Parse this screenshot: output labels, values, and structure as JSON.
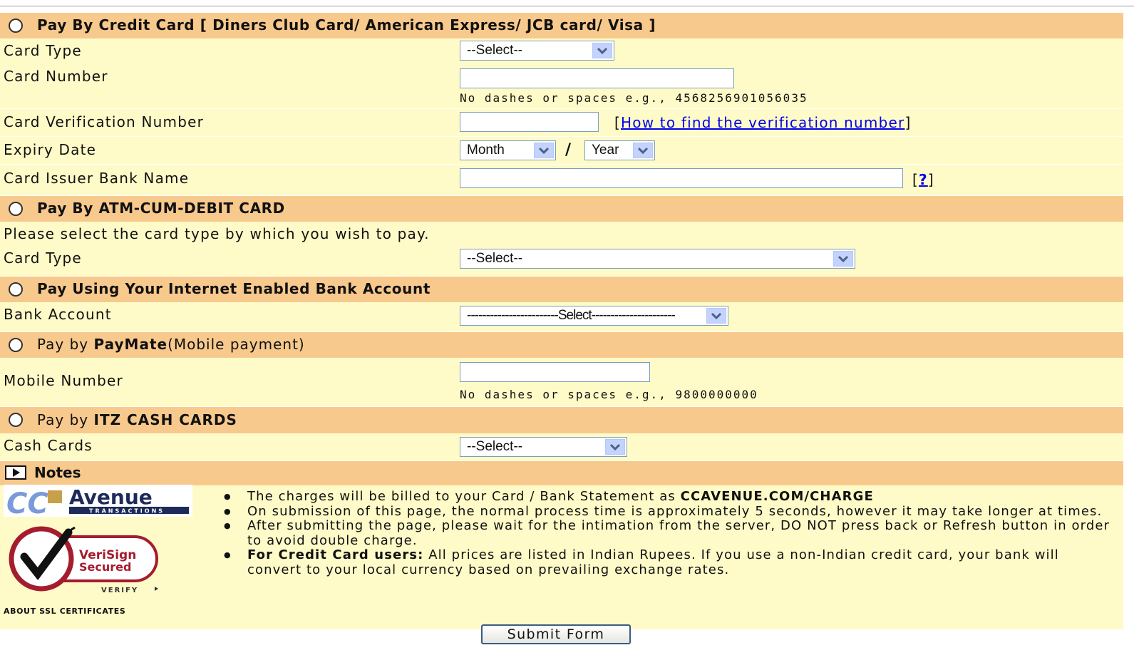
{
  "credit_card": {
    "title": "Pay By Credit Card [ Diners Club Card/ American Express/ JCB card/ Visa ]",
    "card_type_label": "Card Type",
    "card_type_value": "--Select--",
    "card_number_label": "Card Number",
    "card_number_hint": "No dashes or spaces e.g., 4568256901056035",
    "cvv_label": "Card Verification Number",
    "cvv_link": "How to find the verification number",
    "expiry_label": "Expiry Date",
    "expiry_month": "Month",
    "expiry_separator": "/",
    "expiry_year": "Year",
    "issuer_label": "Card Issuer Bank Name",
    "issuer_help": "?"
  },
  "debit_card": {
    "title": "Pay By ATM-CUM-DEBIT CARD",
    "instruction": "Please select the card type by which you wish to pay.",
    "card_type_label": "Card Type",
    "card_type_value": "--Select--"
  },
  "net_banking": {
    "title": "Pay Using Your Internet Enabled Bank Account",
    "bank_label": "Bank Account",
    "bank_value": "------------------------Select----------------------"
  },
  "paymate": {
    "title_prefix": "Pay by ",
    "title_bold": "PayMate",
    "title_suffix": "(Mobile payment)",
    "mobile_label": "Mobile Number",
    "mobile_hint": "No dashes or spaces e.g., 9800000000"
  },
  "itz": {
    "title_prefix": "Pay by ",
    "title_bold": "ITZ CASH CARDS",
    "cash_label": "Cash Cards",
    "cash_value": "--Select--"
  },
  "notes": {
    "title": "Notes",
    "items": [
      {
        "bold": "",
        "text": "The charges will be billed to your Card / Bank Statement as ",
        "tail_bold": "CCAVENUE.COM/CHARGE"
      },
      {
        "bold": "",
        "text": "On submission of this page, the normal process time is approximately 5 seconds, however it may take longer at times.",
        "tail_bold": ""
      },
      {
        "bold": "",
        "text": "After submitting the page, please wait for the intimation from the server, DO NOT press back or Refresh button in order to avoid double charge.",
        "tail_bold": ""
      },
      {
        "bold": "For Credit Card users:",
        "text": " All prices are listed in Indian Rupees. If you use a non-Indian credit card, your bank will convert to your local currency based on prevailing exchange rates.",
        "tail_bold": ""
      }
    ]
  },
  "logos": {
    "ccavenue_main": "Avenue",
    "ccavenue_sub": "TRANSACTIONS",
    "verisign_line1": "VeriSign",
    "verisign_line2": "Secured",
    "verisign_verify": "VERIFY",
    "ssl_text": "ABOUT SSL CERTIFICATES"
  },
  "submit_label": "Submit Form",
  "colors": {
    "header_bg": "#f8c98d",
    "body_bg": "#fefbc8",
    "link": "#0000ee"
  }
}
